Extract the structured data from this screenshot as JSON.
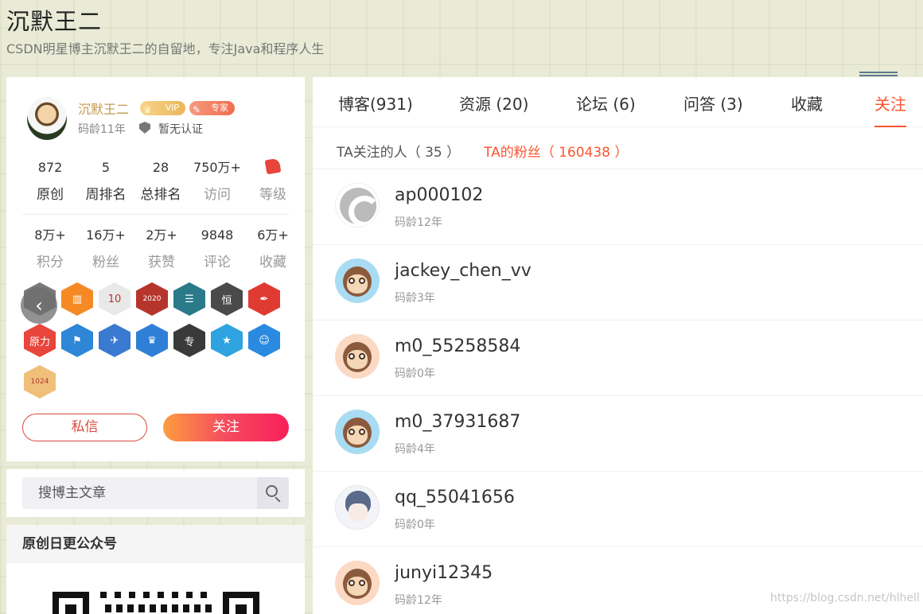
{
  "header": {
    "title": "沉默王二",
    "subtitle": "CSDN明星博主沉默王二的自留地，专注Java和程序人生"
  },
  "profile": {
    "name": "沉默王二",
    "vip_label": "VIP",
    "expert_label": "专家",
    "code_age": "码龄11年",
    "certification": "暂无认证",
    "stats_row1": [
      {
        "value": "872",
        "label": "原创"
      },
      {
        "value": "5",
        "label": "周排名"
      },
      {
        "value": "28",
        "label": "总排名"
      },
      {
        "value": "750万+",
        "label": "访问"
      },
      {
        "value": "",
        "label": "等级"
      }
    ],
    "stats_row2": [
      {
        "value": "8万+",
        "label": "积分"
      },
      {
        "value": "16万+",
        "label": "粉丝"
      },
      {
        "value": "2万+",
        "label": "获赞"
      },
      {
        "value": "9848",
        "label": "评论"
      },
      {
        "value": "6万+",
        "label": "收藏"
      }
    ],
    "medals": [
      {
        "icon": "gray-medal-icon",
        "color": "#7a7a7a",
        "text": ""
      },
      {
        "icon": "book-medal-icon",
        "color": "#f58a24",
        "text": "▥"
      },
      {
        "icon": "10-year-medal-icon",
        "color": "#e9e9e9",
        "text": "10"
      },
      {
        "icon": "2020-medal-icon",
        "color": "#b5352c",
        "text": "2020"
      },
      {
        "icon": "list-medal-icon",
        "color": "#2a7a8a",
        "text": "☰"
      },
      {
        "icon": "persist-medal-icon",
        "color": "#4a4a4a",
        "text": "恒"
      },
      {
        "icon": "pen-medal-icon",
        "color": "#e03b33",
        "text": "✒"
      },
      {
        "icon": "yuanli-medal-icon",
        "color": "#e8453c",
        "text": "原力"
      },
      {
        "icon": "flag-medal-icon",
        "color": "#2e86d6",
        "text": "⚑"
      },
      {
        "icon": "rocket-medal-icon",
        "color": "#3a7ad0",
        "text": "✈"
      },
      {
        "icon": "crown-medal-icon",
        "color": "#2f7fd6",
        "text": "♛"
      },
      {
        "icon": "pro-medal-icon",
        "color": "#3a3a3a",
        "text": "专"
      },
      {
        "icon": "star-medal-icon",
        "color": "#2fa3e0",
        "text": "★"
      },
      {
        "icon": "astronaut-medal-icon",
        "color": "#2a8ae0",
        "text": "☺"
      },
      {
        "icon": "1024-medal-icon",
        "color": "#f0c07a",
        "text": "1024"
      }
    ],
    "message_button": "私信",
    "follow_button": "关注"
  },
  "search": {
    "placeholder": "搜博主文章"
  },
  "qr_section": {
    "title": "原创日更公众号"
  },
  "tabs": [
    {
      "label": "博客(931)"
    },
    {
      "label": "资源 (20)"
    },
    {
      "label": "论坛 (6)"
    },
    {
      "label": "问答 (3)"
    },
    {
      "label": "收藏"
    },
    {
      "label": "关注"
    }
  ],
  "subtabs": [
    {
      "label": "TA关注的人（ 35 ）"
    },
    {
      "label": "TA的粉丝（ 160438 ）"
    }
  ],
  "users": [
    {
      "name": "ap000102",
      "age": "码龄12年",
      "avatar": "csdn"
    },
    {
      "name": "jackey_chen_vv",
      "age": "码龄3年",
      "avatar": "monkey-blue"
    },
    {
      "name": "m0_55258584",
      "age": "码龄0年",
      "avatar": "monkey-peach"
    },
    {
      "name": "m0_37931687",
      "age": "码龄4年",
      "avatar": "monkey-blue"
    },
    {
      "name": "qq_55041656",
      "age": "码龄0年",
      "avatar": "anime"
    },
    {
      "name": "junyi12345",
      "age": "码龄12年",
      "avatar": "monkey-peach"
    }
  ],
  "watermark": "https://blog.csdn.net/hlhell",
  "colors": {
    "accent": "#fc5531",
    "vip": "#eab659",
    "expert": "#f06c4f"
  }
}
